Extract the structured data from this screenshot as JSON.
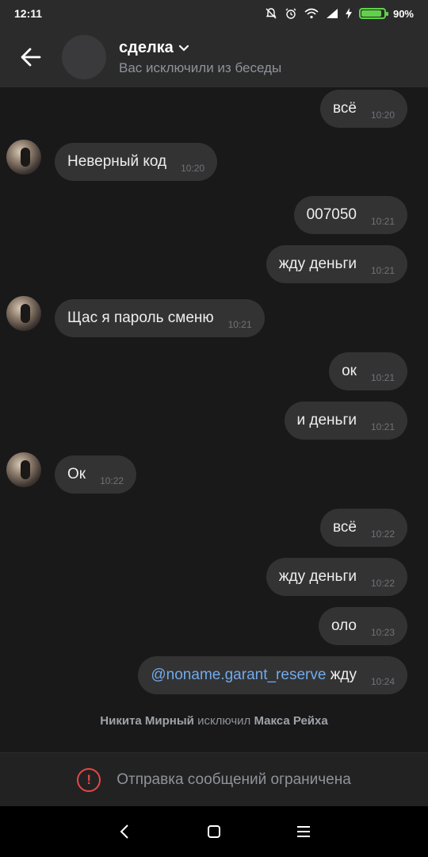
{
  "status": {
    "time": "12:11",
    "battery": "90%",
    "battery_level": 0.9
  },
  "header": {
    "title": "сделка",
    "subtitle": "Вас исключили из беседы"
  },
  "messages": [
    {
      "dir": "out",
      "text": "всё",
      "time": "10:20"
    },
    {
      "dir": "in",
      "text": "Неверный код",
      "time": "10:20"
    },
    {
      "dir": "out",
      "text": "007050",
      "time": "10:21"
    },
    {
      "dir": "out",
      "text": "жду деньги",
      "time": "10:21"
    },
    {
      "dir": "in",
      "text": "Щас я пароль сменю",
      "time": "10:21"
    },
    {
      "dir": "out",
      "text": "ок",
      "time": "10:21"
    },
    {
      "dir": "out",
      "text": "и деньги",
      "time": "10:21"
    },
    {
      "dir": "in",
      "text": "Ок",
      "time": "10:22"
    },
    {
      "dir": "out",
      "text": "всё",
      "time": "10:22"
    },
    {
      "dir": "out",
      "text": "жду деньги",
      "time": "10:22"
    },
    {
      "dir": "out",
      "text": "оло",
      "time": "10:23"
    },
    {
      "dir": "out",
      "mention": "@noname.garant_reserve",
      "text": " жду",
      "time": "10:24"
    }
  ],
  "service_message": {
    "actor": "Никита Мирный",
    "action": "исключил",
    "target": "Макса Рейха"
  },
  "restriction": {
    "icon": "!",
    "text": "Отправка сообщений ограничена"
  },
  "colors": {
    "accent": "#71aaeb",
    "warning": "#e64646",
    "bubble": "#333334"
  }
}
